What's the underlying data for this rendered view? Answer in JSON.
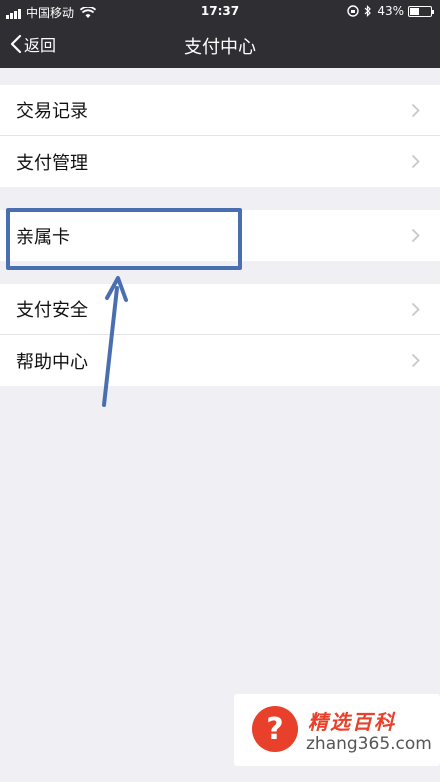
{
  "status_bar": {
    "carrier": "中国移动",
    "time": "17:37",
    "battery_text": "43%",
    "battery_level": 0.43
  },
  "navbar": {
    "back_label": "返回",
    "title": "支付中心"
  },
  "groups": [
    {
      "items": [
        {
          "label": "交易记录"
        },
        {
          "label": "支付管理"
        }
      ]
    },
    {
      "items": [
        {
          "label": "亲属卡"
        }
      ]
    },
    {
      "items": [
        {
          "label": "支付安全"
        },
        {
          "label": "帮助中心"
        }
      ]
    }
  ],
  "annotation": {
    "color": "#4a6fb1"
  },
  "watermark": {
    "symbol": "?",
    "brand": "精选百科",
    "url": "zhang365.com"
  },
  "icons": [
    "signal-icon",
    "wifi-icon",
    "lock-rotation-icon",
    "bluetooth-icon",
    "battery-icon",
    "back-chevron-icon",
    "chevron-right-icon"
  ],
  "colors": {
    "navbar": "#2e2e33",
    "background": "#efeff4",
    "brand_red": "#e8402a"
  }
}
